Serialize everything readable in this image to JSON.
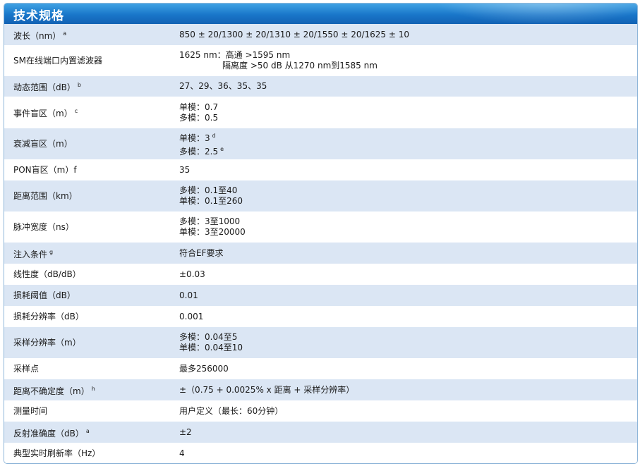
{
  "title": "技术规格",
  "rows": [
    {
      "label": "波长（nm）",
      "sup": "a",
      "values": [
        "850 ± 20/1300 ± 20/1310 ± 20/1550 ± 20/1625 ± 10"
      ]
    },
    {
      "label": "SM在线端口内置滤波器",
      "sup": "",
      "values": [
        "1625 nm：高通 >1595 nm",
        "隔离度 >50 dB 从1270 nm到1585 nm"
      ]
    },
    {
      "label": "动态范围（dB）",
      "sup": "b",
      "values": [
        "27、29、36、35、35"
      ]
    },
    {
      "label": "事件盲区（m）",
      "sup": "c",
      "values": [
        "单模：0.7",
        "多模：0.5"
      ]
    },
    {
      "label": "衰减盲区（m）",
      "sup": "",
      "values": [
        "单模：3",
        "多模：2.5"
      ],
      "value_sups": [
        "d",
        "e"
      ]
    },
    {
      "label": "PON盲区（m）f",
      "sup": "",
      "values": [
        "35"
      ]
    },
    {
      "label": "距离范围（km）",
      "sup": "",
      "values": [
        "多模：0.1至40",
        "单模：0.1至260"
      ]
    },
    {
      "label": "脉冲宽度（ns）",
      "sup": "",
      "values": [
        "多模：3至1000",
        "单模：3至20000"
      ]
    },
    {
      "label": "注入条件",
      "sup": "g",
      "values": [
        "符合EF要求"
      ]
    },
    {
      "label": "线性度（dB/dB）",
      "sup": "",
      "values": [
        "±0.03"
      ]
    },
    {
      "label": "损耗阈值（dB）",
      "sup": "",
      "values": [
        "0.01"
      ]
    },
    {
      "label": "损耗分辨率（dB）",
      "sup": "",
      "values": [
        "0.001"
      ]
    },
    {
      "label": "采样分辨率（m）",
      "sup": "",
      "values": [
        "多模：0.04至5",
        "单模：0.04至10"
      ]
    },
    {
      "label": "采样点",
      "sup": "",
      "values": [
        "最多256000"
      ]
    },
    {
      "label": "距离不确定度（m）",
      "sup": "h",
      "values": [
        "±（0.75 + 0.0025% x 距离 + 采样分辨率）"
      ]
    },
    {
      "label": "测量时间",
      "sup": "",
      "values": [
        "用户定义（最长：60分钟）"
      ]
    },
    {
      "label": "反射准确度（dB）",
      "sup": "a",
      "values": [
        "±2"
      ]
    },
    {
      "label": "典型实时刷新率（Hz）",
      "sup": "",
      "values": [
        "4"
      ]
    }
  ]
}
